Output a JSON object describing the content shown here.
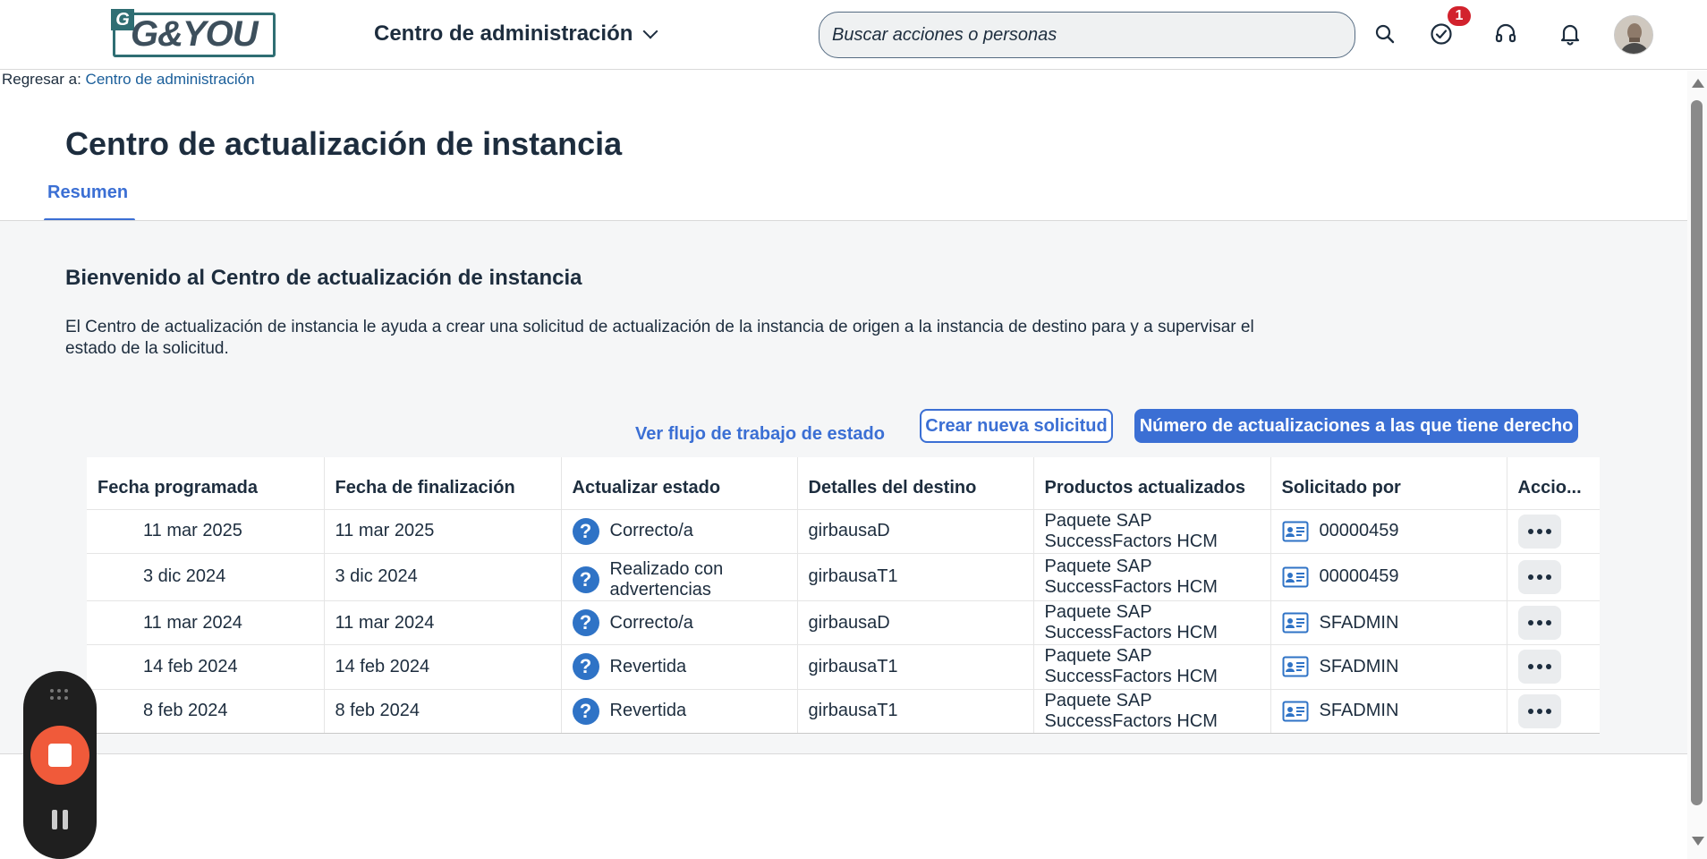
{
  "brand": {
    "logo_letter": "G",
    "logo_text": "G&YOU"
  },
  "header": {
    "app_title": "Centro de administración",
    "search_placeholder": "Buscar acciones o personas",
    "notification_badge": "1"
  },
  "breadcrumb": {
    "prefix": "Regresar a: ",
    "link": "Centro de administración"
  },
  "page": {
    "title": "Centro de actualización de instancia",
    "tab": "Resumen"
  },
  "welcome": {
    "heading": "Bienvenido al Centro de actualización de instancia",
    "description": "El Centro de actualización de instancia le ayuda a crear una solicitud de actualización de la instancia de origen a la instancia de destino para y a supervisar el estado de la solicitud."
  },
  "actions": {
    "workflow_link": "Ver flujo de trabajo de estado",
    "create_button": "Crear nueva solicitud",
    "entitlement_button": "Número de actualizaciones a las que tiene derecho"
  },
  "table": {
    "columns": [
      "Fecha programada",
      "Fecha de finalización",
      "Actualizar estado",
      "Detalles del destino",
      "Productos actualizados",
      "Solicitado por",
      "Accio..."
    ],
    "rows": [
      {
        "scheduled": "11 mar 2025",
        "finished": "11 mar 2025",
        "status": "Correcto/a",
        "target": "girbausaD",
        "product": "Paquete SAP SuccessFactors HCM",
        "requested_by": "00000459"
      },
      {
        "scheduled": "3 dic 2024",
        "finished": "3 dic 2024",
        "status": "Realizado con advertencias",
        "target": "girbausaT1",
        "product": "Paquete SAP SuccessFactors HCM",
        "requested_by": "00000459"
      },
      {
        "scheduled": "11 mar 2024",
        "finished": "11 mar 2024",
        "status": "Correcto/a",
        "target": "girbausaD",
        "product": "Paquete SAP SuccessFactors HCM",
        "requested_by": "SFADMIN"
      },
      {
        "scheduled": "14 feb 2024",
        "finished": "14 feb 2024",
        "status": "Revertida",
        "target": "girbausaT1",
        "product": "Paquete SAP SuccessFactors HCM",
        "requested_by": "SFADMIN"
      },
      {
        "scheduled": "8 feb 2024",
        "finished": "8 feb 2024",
        "status": "Revertida",
        "target": "girbausaT1",
        "product": "Paquete SAP SuccessFactors HCM",
        "requested_by": "SFADMIN"
      }
    ]
  },
  "icons": {
    "status": "question-circle-icon",
    "requester": "id-card-icon",
    "actions": "more-icon"
  },
  "colors": {
    "accent": "#3b6fd4",
    "status_icon": "#2f73c6",
    "badge": "#d2222d",
    "recorder_stop": "#f05a3a"
  }
}
